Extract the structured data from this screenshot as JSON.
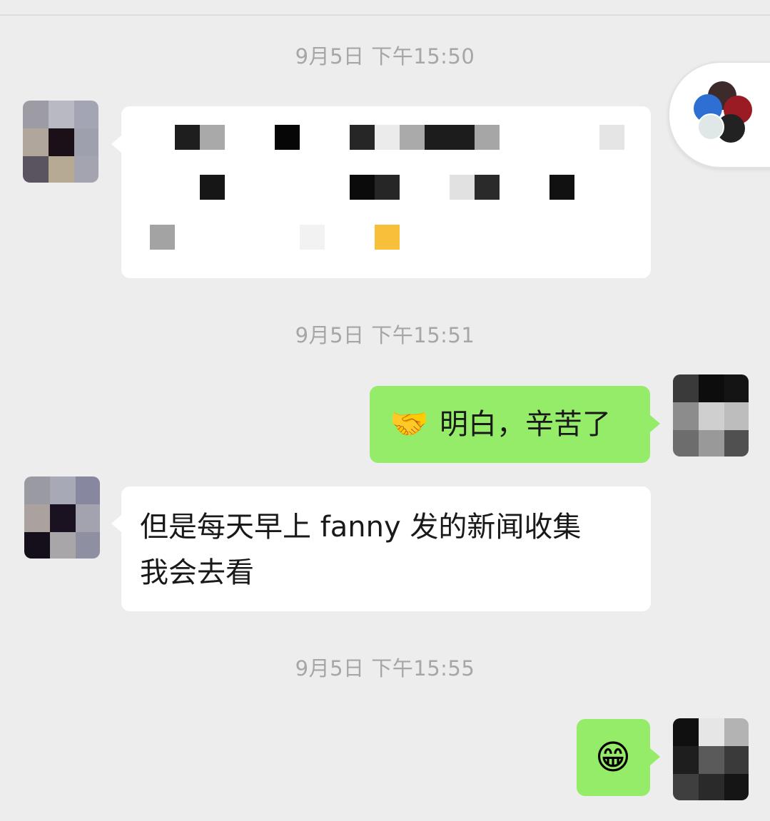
{
  "chat": {
    "timestamps": [
      "9月5日 下午15:50",
      "9月5日 下午15:51",
      "9月5日 下午15:55"
    ],
    "messages": [
      {
        "sender": "other",
        "type": "redacted"
      },
      {
        "sender": "self",
        "type": "text",
        "emoji": "handshake",
        "text": "明白，辛苦了"
      },
      {
        "sender": "other",
        "type": "text",
        "lines": [
          "但是每天早上 fanny 发的新闻收集",
          "我会去看"
        ]
      },
      {
        "sender": "self",
        "type": "emoji",
        "emoji": "grin"
      }
    ]
  },
  "colors": {
    "background": "#ededed",
    "incoming_bubble": "#ffffff",
    "outgoing_bubble": "#95ec69",
    "timestamp_text": "#a6a6a6"
  },
  "floating_widget": {
    "icon": "multi-circle-logo-icon"
  }
}
